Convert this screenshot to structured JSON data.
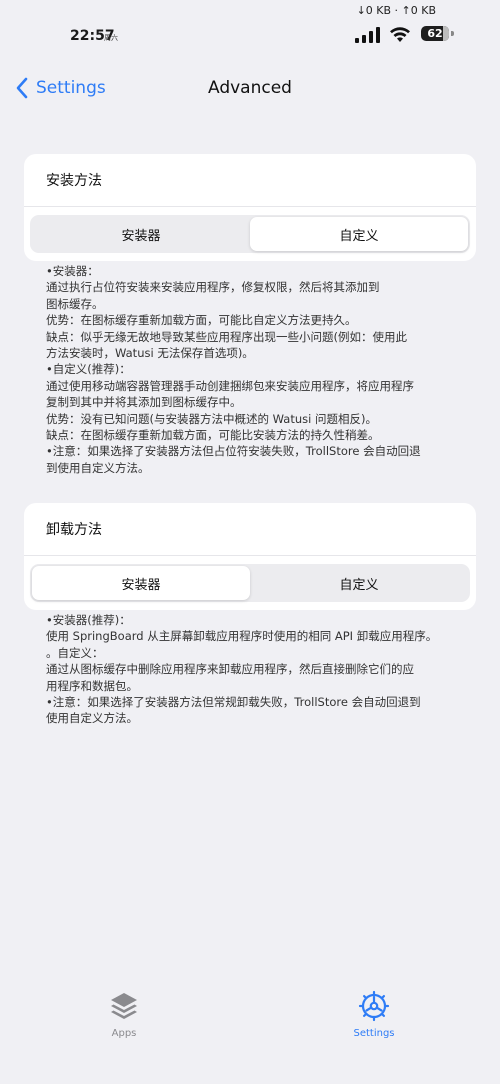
{
  "status_bar": {
    "net_speed": "↓0 KB · ↑0 KB",
    "time": "22:57",
    "time_suffix": "周六",
    "battery": "62"
  },
  "nav": {
    "back_label": "Settings",
    "title": "Advanced"
  },
  "install_section": {
    "header": "安装方法",
    "options": [
      "安装器",
      "自定义"
    ],
    "selected": "自定义",
    "description": [
      "•安装器：",
      "通过执行占位符安装来安装应用程序，修复权限，然后将其添加到",
      "图标缓存。",
      "优势：在图标缓存重新加载方面，可能比自定义方法更持久。",
      "缺点：似乎无缘无故地导致某些应用程序出现一些小问题(例如：使用此",
      "方法安装时，Watusi 无法保存首选项)。",
      "•自定义(推荐)：",
      "通过使用移动端容器管理器手动创建捆绑包来安装应用程序，将应用程序",
      "复制到其中并将其添加到图标缓存中。",
      "优势：没有已知问题(与安装器方法中概述的 Watusi 问题相反)。",
      "缺点：在图标缓存重新加载方面，可能比安装方法的持久性稍差。",
      "•注意：如果选择了安装器方法但占位符安装失败，TrollStore 会自动回退",
      "到使用自定义方法。"
    ]
  },
  "uninstall_section": {
    "header": "卸载方法",
    "options": [
      "安装器",
      "自定义"
    ],
    "selected": "安装器",
    "description": [
      "•安装器(推荐)：",
      "使用 SpringBoard 从主屏幕卸载应用程序时使用的相同 API 卸载应用程序。",
      "。自定义：",
      "通过从图标缓存中删除应用程序来卸载应用程序，然后直接删除它们的应",
      "用程序和数据包。",
      "•注意：如果选择了安装器方法但常规卸载失败，TrollStore 会自动回退到",
      "使用自定义方法。"
    ]
  },
  "tabbar": {
    "apps_label": "Apps",
    "settings_label": "Settings",
    "active": "Settings"
  },
  "colors": {
    "accent": "#2e7cf6",
    "background": "#f0f0f4",
    "card": "#ffffff"
  },
  "icons": {
    "back": "chevron-left-icon",
    "apps": "layers-stack-icon",
    "settings": "gear-icon",
    "signal": "cellular-signal-icon",
    "wifi": "wifi-icon",
    "battery": "battery-icon"
  }
}
